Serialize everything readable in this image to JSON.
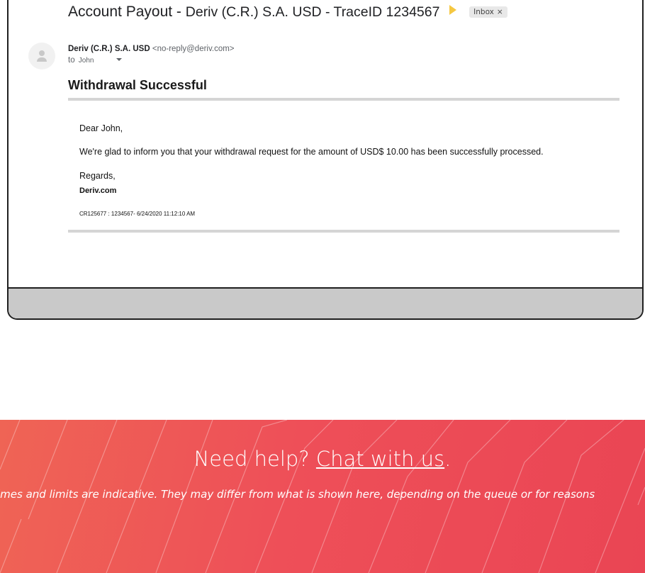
{
  "email": {
    "subject_main": "Account Payout - ",
    "subject_sender": "Deriv (C.R.) S.A. USD - TraceID 1234567",
    "inbox_chip": "Inbox",
    "inbox_chip_close": "×",
    "from_name": "Deriv (C.R.) S.A. USD",
    "from_address": "<no-reply@deriv.com>",
    "to_label": "to",
    "to_name": "John",
    "heading": "Withdrawal Successful",
    "greeting_word": "Dear",
    "greeting_name": "John,",
    "message": "We're glad to inform you that your withdrawal request for the amount of USD$ 10.00 has been successfully processed.",
    "regards": "Regards,",
    "signature": "Deriv.com",
    "reference": "CR125677 : 1234567- 6/24/2020 11:12:10 AM"
  },
  "help": {
    "prompt": "Need help? ",
    "chat_link": "Chat with us",
    "period": ".",
    "disclaimer": "imes and limits are indicative. They may differ from what is shown here, depending on the queue or for reasons"
  },
  "colors": {
    "banner": "#ee4f58",
    "label_arrow": "#f5c842",
    "card_footer": "#c9c9c9"
  }
}
